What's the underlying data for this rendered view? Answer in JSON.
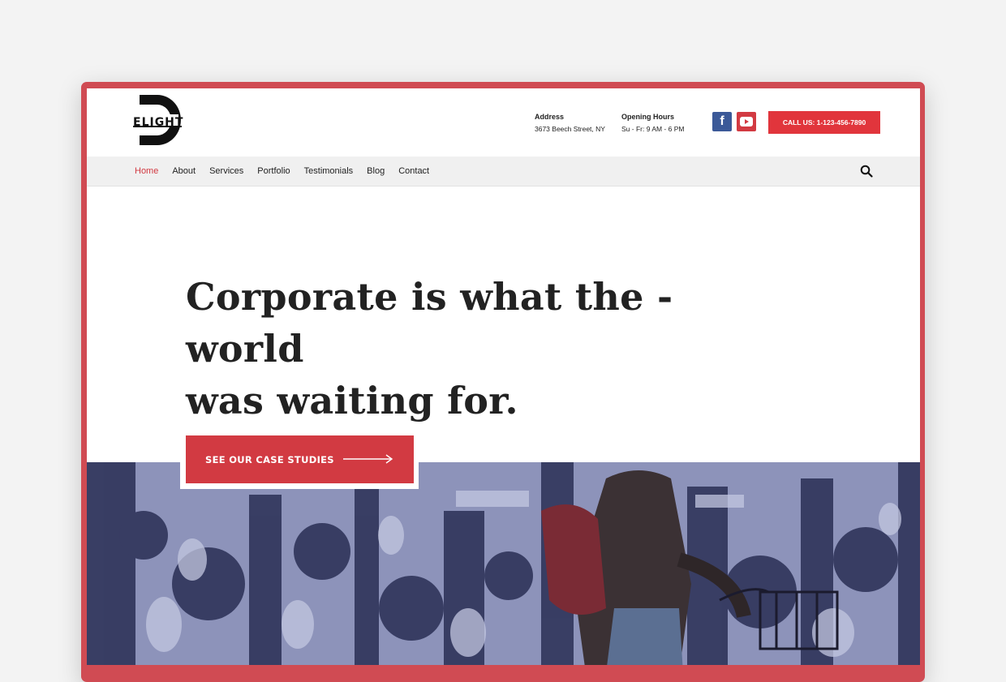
{
  "header": {
    "logo_letters": "ELIGHT",
    "address": {
      "title": "Address",
      "value": "3673 Beech Street, NY"
    },
    "hours": {
      "title": "Opening Hours",
      "value": "Su - Fr: 9 AM - 6 PM"
    },
    "social": [
      {
        "icon": "facebook-icon",
        "glyph": "f"
      },
      {
        "icon": "youtube-icon"
      }
    ],
    "call_label": "CALL US: 1-123-456-7890"
  },
  "nav": {
    "items": [
      {
        "label": "Home",
        "active": true
      },
      {
        "label": "About"
      },
      {
        "label": "Services"
      },
      {
        "label": "Portfolio"
      },
      {
        "label": "Testimonials"
      },
      {
        "label": "Blog"
      },
      {
        "label": "Contact"
      }
    ],
    "search_icon": "search-icon"
  },
  "hero": {
    "headline_line1": "Corporate is what the - world",
    "headline_line2": "was waiting for.",
    "cta_label": "SEE OUR CASE STUDIES"
  },
  "colors": {
    "accent": "#d23a42",
    "frame": "#d04b53",
    "facebook": "#3b5998",
    "photo_tint": "#8c92b9"
  }
}
